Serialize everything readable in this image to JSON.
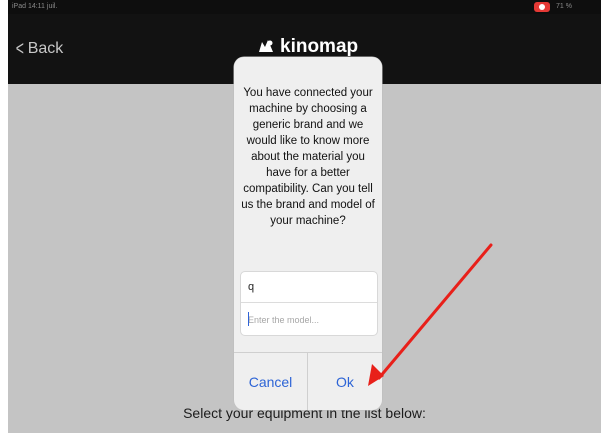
{
  "status_bar": {
    "left_text": "iPad 14:11 juil.",
    "right_text": "71 %"
  },
  "nav": {
    "back_label": "Back",
    "logo_text": "kinomap"
  },
  "dialog": {
    "message": "You have connected your machine by choosing a generic brand and we would like to know more about the material you have for a better compatibility. Can you tell us the brand and model of your machine?",
    "brand_value": "q",
    "model_placeholder": "Enter the model...",
    "cancel_label": "Cancel",
    "ok_label": "Ok"
  },
  "footer": {
    "text": "Select your equipment in the list below:"
  },
  "colors": {
    "accent": "#2d64d6",
    "annotation_arrow": "#e8201a",
    "record": "#e53935"
  }
}
